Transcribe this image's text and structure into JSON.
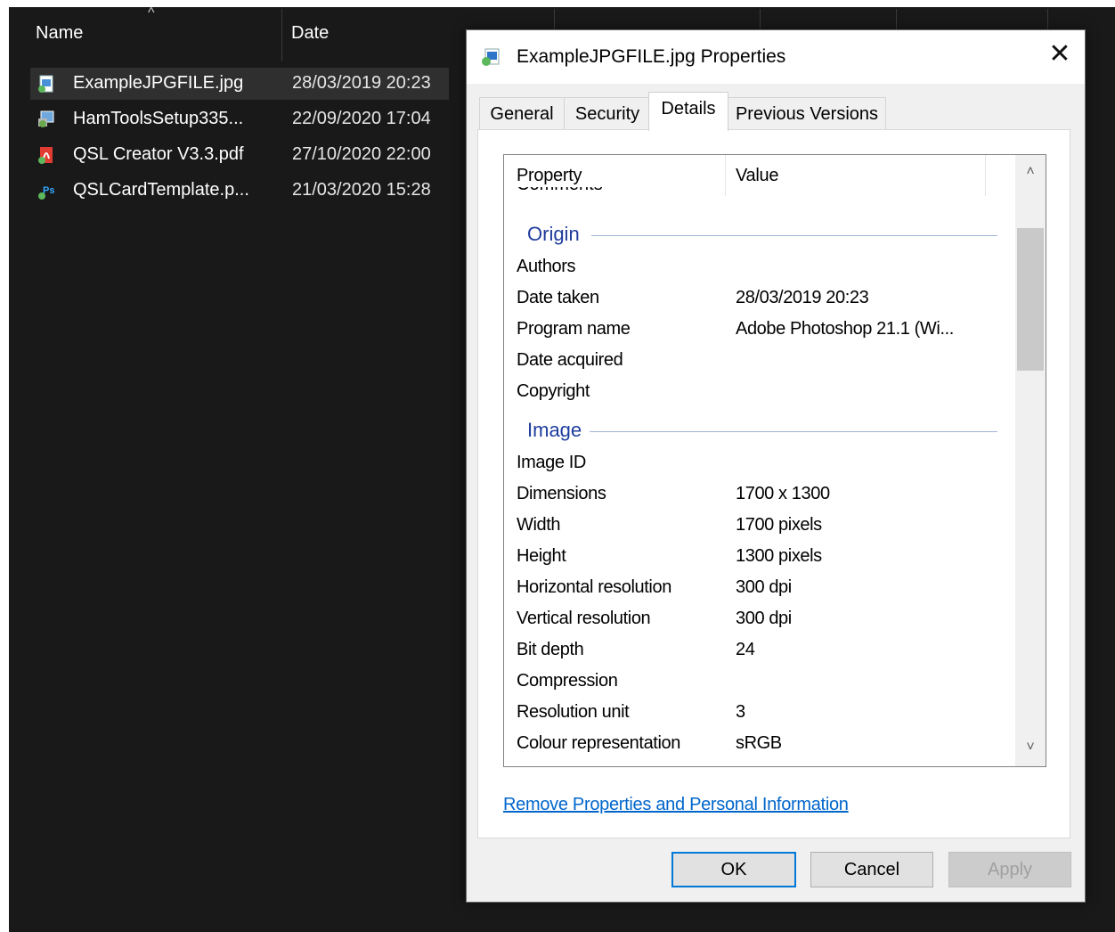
{
  "explorer": {
    "columns": [
      {
        "label": "Name"
      },
      {
        "label": "Date"
      }
    ],
    "files": [
      {
        "name": "ExampleJPGFILE.jpg",
        "date": "28/03/2019 20:23",
        "icon": "jpg-image-icon",
        "color": "#4a90d9"
      },
      {
        "name": "HamToolsSetup335...",
        "date": "22/09/2020 17:04",
        "icon": "installer-icon",
        "color": "#6aa84f"
      },
      {
        "name": "QSL Creator V3.3.pdf",
        "date": "27/10/2020 22:00",
        "icon": "pdf-icon",
        "color": "#e03c31"
      },
      {
        "name": "QSLCardTemplate.p...",
        "date": "21/03/2020 15:28",
        "icon": "photoshop-file-icon",
        "color": "#31a8ff"
      }
    ]
  },
  "dialog": {
    "title": "ExampleJPGFILE.jpg Properties",
    "close_symbol": "✕",
    "tabs": [
      "General",
      "Security",
      "Details",
      "Previous Versions"
    ],
    "active_tab": "Details",
    "list": {
      "header_property": "Property",
      "header_value": "Value",
      "clipped_row": "Comments",
      "groups": [
        {
          "title": "Origin",
          "rows": [
            {
              "key": "Authors",
              "value": ""
            },
            {
              "key": "Date taken",
              "value": "28/03/2019 20:23"
            },
            {
              "key": "Program name",
              "value": "Adobe Photoshop 21.1 (Wi..."
            },
            {
              "key": "Date acquired",
              "value": ""
            },
            {
              "key": "Copyright",
              "value": ""
            }
          ]
        },
        {
          "title": "Image",
          "rows": [
            {
              "key": "Image ID",
              "value": ""
            },
            {
              "key": "Dimensions",
              "value": "1700 x 1300"
            },
            {
              "key": "Width",
              "value": "1700 pixels"
            },
            {
              "key": "Height",
              "value": "1300 pixels"
            },
            {
              "key": "Horizontal resolution",
              "value": "300 dpi"
            },
            {
              "key": "Vertical resolution",
              "value": "300 dpi"
            },
            {
              "key": "Bit depth",
              "value": "24"
            },
            {
              "key": "Compression",
              "value": ""
            },
            {
              "key": "Resolution unit",
              "value": "3"
            },
            {
              "key": "Colour representation",
              "value": "sRGB"
            }
          ]
        }
      ]
    },
    "link": "Remove Properties and Personal Information",
    "buttons": {
      "ok": "OK",
      "cancel": "Cancel",
      "apply": "Apply"
    }
  }
}
